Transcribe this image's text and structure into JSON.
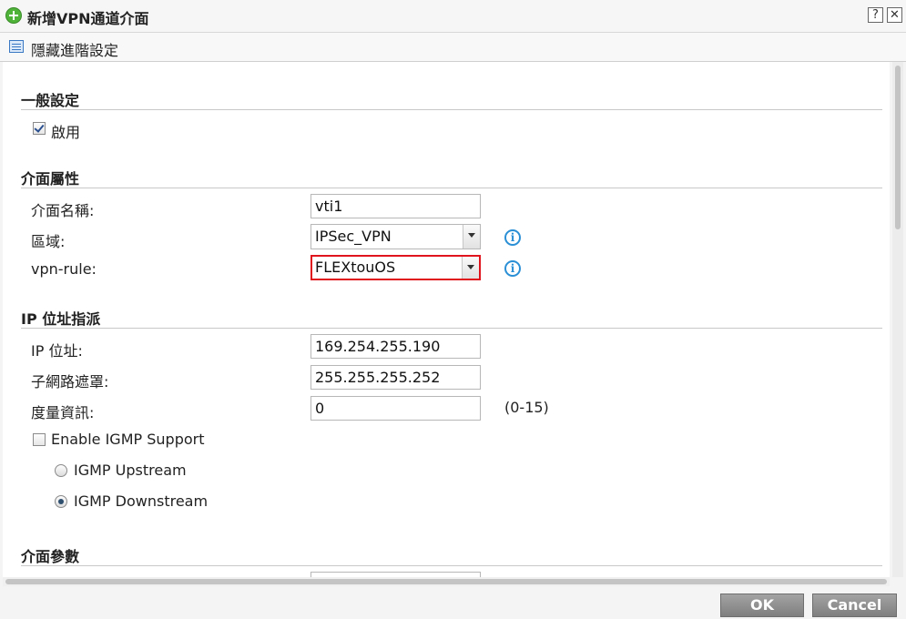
{
  "window": {
    "title": "新增VPN通道介面",
    "help_label": "?",
    "close_label": "✕"
  },
  "toolbar": {
    "hide_advanced_label": "隱藏進階設定"
  },
  "sections": {
    "general": "一般設定",
    "interface_props": "介面屬性",
    "ip_assign": "IP 位址指派",
    "interface_params": "介面參數"
  },
  "general": {
    "enable_label": "啟用",
    "enable_checked": true
  },
  "interface": {
    "name_label": "介面名稱:",
    "name_value": "vti1",
    "zone_label": "區域:",
    "zone_value": "IPSec_VPN",
    "vpn_rule_label": "vpn-rule:",
    "vpn_rule_value": "FLEXtouOS",
    "info_glyph": "i"
  },
  "ip": {
    "address_label": "IP 位址:",
    "address_value": "169.254.255.190",
    "mask_label": "子網路遮罩:",
    "mask_value": "255.255.255.252",
    "metric_label": "度量資訊:",
    "metric_value": "0",
    "metric_range": "(0-15)",
    "igmp_enable_label": "Enable IGMP Support",
    "igmp_enable_checked": false,
    "igmp_upstream_label": "IGMP Upstream",
    "igmp_downstream_label": "IGMP Downstream",
    "igmp_selected": "downstream"
  },
  "footer": {
    "ok_label": "OK",
    "cancel_label": "Cancel"
  },
  "colors": {
    "highlight_border": "#e0141d",
    "info_icon": "#2b8fd6",
    "add_icon": "#4fb33a"
  }
}
